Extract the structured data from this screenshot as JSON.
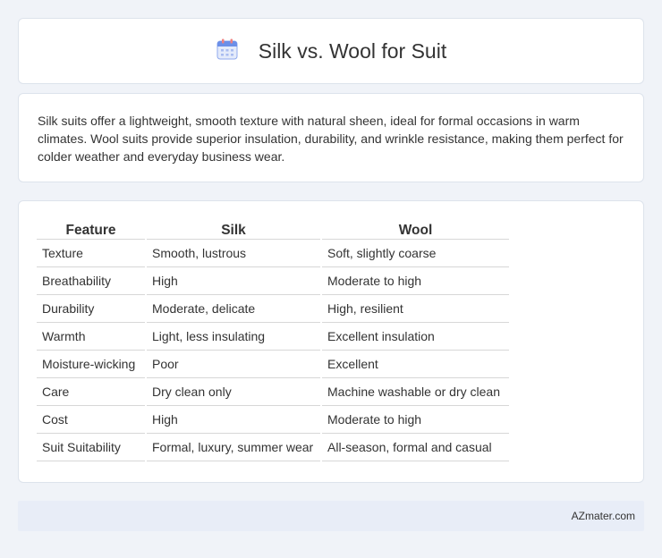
{
  "header": {
    "title": "Silk vs. Wool for Suit",
    "icon": "calendar-icon"
  },
  "description": "Silk suits offer a lightweight, smooth texture with natural sheen, ideal for formal occasions in warm climates. Wool suits provide superior insulation, durability, and wrinkle resistance, making them perfect for colder weather and everyday business wear.",
  "table": {
    "headers": [
      "Feature",
      "Silk",
      "Wool"
    ],
    "rows": [
      [
        "Texture",
        "Smooth, lustrous",
        "Soft, slightly coarse"
      ],
      [
        "Breathability",
        "High",
        "Moderate to high"
      ],
      [
        "Durability",
        "Moderate, delicate",
        "High, resilient"
      ],
      [
        "Warmth",
        "Light, less insulating",
        "Excellent insulation"
      ],
      [
        "Moisture-wicking",
        "Poor",
        "Excellent"
      ],
      [
        "Care",
        "Dry clean only",
        "Machine washable or dry clean"
      ],
      [
        "Cost",
        "High",
        "Moderate to high"
      ],
      [
        "Suit Suitability",
        "Formal, luxury, summer wear",
        "All-season, formal and casual"
      ]
    ]
  },
  "footer": {
    "site": "AZmater.com"
  },
  "colors": {
    "background": "#f0f3f8",
    "card": "#ffffff",
    "footer_bg": "#e8edf7",
    "icon_blue": "#6b8fe8",
    "icon_red": "#f08080"
  }
}
